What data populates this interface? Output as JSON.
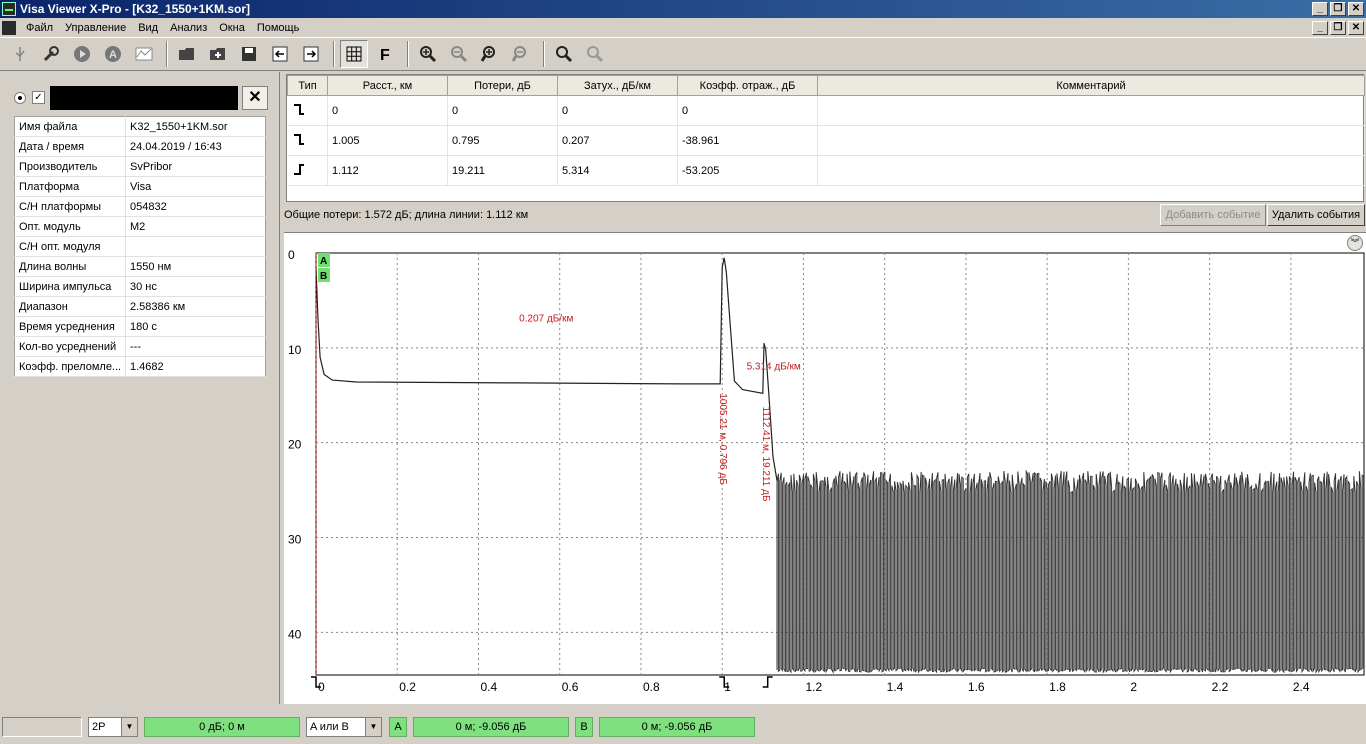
{
  "window": {
    "title": "Visa Viewer X-Pro - [K32_1550+1KM.sor]"
  },
  "menu": [
    "Файл",
    "Управление",
    "Вид",
    "Анализ",
    "Окна",
    "Помощь"
  ],
  "toolbar": {
    "icons": [
      "usb-icon",
      "wrench-icon",
      "play-icon",
      "auto-icon",
      "trace-icon",
      "open-folder-icon",
      "add-folder-icon",
      "save-icon",
      "prev-icon",
      "next-icon",
      "grid-icon",
      "f-icon",
      "zoom-in-icon",
      "zoom-out-icon",
      "zoom-in-alt-icon",
      "zoom-out-alt-icon",
      "search-icon",
      "search-alt-icon"
    ]
  },
  "file_panel": {
    "properties": [
      {
        "key": "Имя файла",
        "value": "K32_1550+1KM.sor"
      },
      {
        "key": "Дата / время",
        "value": "24.04.2019 / 16:43"
      },
      {
        "key": "Производитель",
        "value": "SvPribor"
      },
      {
        "key": "Платформа",
        "value": "Visa"
      },
      {
        "key": "С/Н платформы",
        "value": "054832"
      },
      {
        "key": "Опт. модуль",
        "value": "M2"
      },
      {
        "key": "С/Н опт. модуля",
        "value": ""
      },
      {
        "key": "Длина волны",
        "value": "1550 нм"
      },
      {
        "key": "Ширина импульса",
        "value": "30 нс"
      },
      {
        "key": "Диапазон",
        "value": "2.58386 км"
      },
      {
        "key": "Время усреднения",
        "value": "180 с"
      },
      {
        "key": "Кол-во усреднений",
        "value": "---"
      },
      {
        "key": "Коэфф. преломле...",
        "value": "1.4682"
      }
    ]
  },
  "events": {
    "headers": [
      "Тип",
      "Расст., км",
      "Потери, дБ",
      "Затух., дБ/км",
      "Коэфф. отраж., дБ",
      "Комментарий"
    ],
    "rows": [
      {
        "type_icon": "reflective-event-icon",
        "dist": "0",
        "loss": "0",
        "atten": "0",
        "refl": "0",
        "comment": ""
      },
      {
        "type_icon": "reflective-event-icon",
        "dist": "1.005",
        "loss": "0.795",
        "atten": "0.207",
        "refl": "-38.961",
        "comment": ""
      },
      {
        "type_icon": "end-event-icon",
        "dist": "1.112",
        "loss": "19.211",
        "atten": "5.314",
        "refl": "-53.205",
        "comment": ""
      }
    ]
  },
  "summary": {
    "text": "Общие потери: 1.572 дБ; длина линии: 1.112 км",
    "add_button": "Добавить событие",
    "delete_button": "Удалить события"
  },
  "chart_data": {
    "type": "line",
    "x_ticks": [
      "0",
      "0.2",
      "0.4",
      "0.6",
      "0.8",
      "1",
      "1.2",
      "1.4",
      "1.6",
      "1.8",
      "2",
      "2.2",
      "2.4"
    ],
    "y_ticks": [
      "0",
      "10",
      "20",
      "30",
      "40"
    ],
    "xlim": [
      0,
      2.58
    ],
    "ylim": [
      0,
      44.5
    ],
    "y_inverted": true,
    "grid": true,
    "series": [
      {
        "color": "#222222",
        "points": [
          [
            0,
            1.5
          ],
          [
            0.005,
            7
          ],
          [
            0.01,
            11
          ],
          [
            0.02,
            12.8
          ],
          [
            0.04,
            13.4
          ],
          [
            0.1,
            13.6
          ],
          [
            0.5,
            13.7
          ],
          [
            0.9,
            13.8
          ],
          [
            0.995,
            13.8
          ],
          [
            1.0,
            1.5
          ],
          [
            1.005,
            0.5
          ],
          [
            1.01,
            2
          ],
          [
            1.03,
            13.5
          ],
          [
            1.05,
            14.4
          ],
          [
            1.1,
            14.8
          ],
          [
            1.103,
            9.5
          ],
          [
            1.107,
            10.2
          ],
          [
            1.115,
            15
          ],
          [
            1.125,
            21.5
          ],
          [
            1.135,
            24
          ]
        ]
      }
    ],
    "noise": {
      "x_start": 1.135,
      "x_end": 2.58,
      "y_top": 23,
      "y_bottom": 44.2
    },
    "annotations": [
      {
        "text": "0.207 дБ/км",
        "x": 0.5,
        "y": 7.2,
        "orientation": "horizontal"
      },
      {
        "text": "5.314 дБ/км",
        "x": 1.06,
        "y": 12.3,
        "orientation": "horizontal"
      },
      {
        "text": "1005.21 м, 0.796 дБ",
        "x": 0.995,
        "y": 14.8,
        "orientation": "vertical"
      },
      {
        "text": "1112.41 м, 19.211 дБ",
        "x": 1.1,
        "y": 16.2,
        "orientation": "vertical"
      }
    ],
    "markers": [
      {
        "label": "A",
        "x": 0
      },
      {
        "label": "B",
        "x": 0
      }
    ],
    "event_markers": [
      0,
      1.005,
      1.112
    ]
  },
  "status": {
    "mode": "2P",
    "cursor_readout": "0 дБ; 0 м",
    "cursor_select": "A или B",
    "a_label": "A",
    "a_value": "0 м; -9.056 дБ",
    "b_label": "B",
    "b_value": "0 м; -9.056 дБ"
  }
}
